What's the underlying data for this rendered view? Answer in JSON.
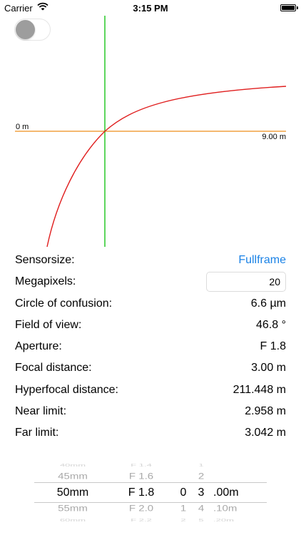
{
  "status_bar": {
    "carrier": "Carrier",
    "time": "3:15 PM"
  },
  "graph": {
    "origin_label": "0 m",
    "end_label": "9.00 m",
    "colors": {
      "axis": "#f0a040",
      "cursor": "#35cc35",
      "curve": "#e01f1f"
    }
  },
  "toggle": {
    "on": false
  },
  "settings": [
    {
      "label": "Sensorsize:",
      "value": "Fullframe",
      "kind": "link"
    },
    {
      "label": "Megapixels:",
      "value": "20",
      "kind": "input"
    },
    {
      "label": "Circle of confusion:",
      "value": "6.6 µm",
      "kind": "text"
    },
    {
      "label": "Field of view:",
      "value": "46.8 °",
      "kind": "text"
    },
    {
      "label": "Aperture:",
      "value": "F 1.8",
      "kind": "text"
    },
    {
      "label": "Focal distance:",
      "value": "3.00 m",
      "kind": "text"
    },
    {
      "label": "Hyperfocal distance:",
      "value": "211.448 m",
      "kind": "text"
    },
    {
      "label": "Near limit:",
      "value": "2.958 m",
      "kind": "text"
    },
    {
      "label": "Far limit:",
      "value": "3.042 m",
      "kind": "text"
    }
  ],
  "picker": {
    "focal_length": [
      "40mm",
      "45mm",
      "50mm",
      "55mm",
      "60mm"
    ],
    "aperture": [
      "F 1.4",
      "F 1.6",
      "F 1.8",
      "F 2.0",
      "F 2.2"
    ],
    "meters": [
      "",
      "",
      "0",
      "1",
      "2"
    ],
    "digit": [
      "1",
      "2",
      "3",
      "4",
      "5"
    ],
    "decimal": [
      "",
      "",
      ".00m",
      ".10m",
      ".20m"
    ],
    "selected_index": 2
  }
}
